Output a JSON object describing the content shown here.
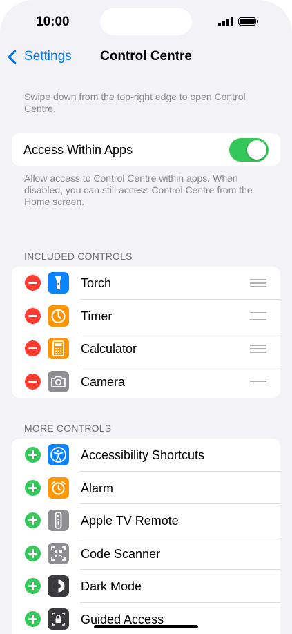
{
  "status_bar": {
    "time": "10:00"
  },
  "nav": {
    "back_label": "Settings",
    "title": "Control Centre"
  },
  "intro_note": "Swipe down from the top-right edge to open Control Centre.",
  "access_within_apps": {
    "label": "Access Within Apps",
    "enabled": true,
    "note": "Allow access to Control Centre within apps. When disabled, you can still access Control Centre from the Home screen."
  },
  "included_controls": {
    "header": "INCLUDED CONTROLS",
    "items": [
      {
        "label": "Torch",
        "icon": "torch-icon",
        "color": "#0a84ff"
      },
      {
        "label": "Timer",
        "icon": "timer-icon",
        "color": "#ff9500"
      },
      {
        "label": "Calculator",
        "icon": "calculator-icon",
        "color": "#ff9500"
      },
      {
        "label": "Camera",
        "icon": "camera-icon",
        "color": "#8e8e93"
      }
    ]
  },
  "more_controls": {
    "header": "MORE CONTROLS",
    "items": [
      {
        "label": "Accessibility Shortcuts",
        "icon": "accessibility-icon",
        "color": "#0a84ff"
      },
      {
        "label": "Alarm",
        "icon": "alarm-icon",
        "color": "#ff9500"
      },
      {
        "label": "Apple TV Remote",
        "icon": "tv-remote-icon",
        "color": "#8e8e93"
      },
      {
        "label": "Code Scanner",
        "icon": "qr-code-icon",
        "color": "#8e8e93"
      },
      {
        "label": "Dark Mode",
        "icon": "dark-mode-icon",
        "color": "#3a3a3c"
      },
      {
        "label": "Guided Access",
        "icon": "lock-icon",
        "color": "#3a3a3c"
      }
    ]
  },
  "colors": {
    "accent": "#007aff",
    "remove": "#ff3b30",
    "add": "#34c759",
    "background": "#f2f2f7"
  }
}
